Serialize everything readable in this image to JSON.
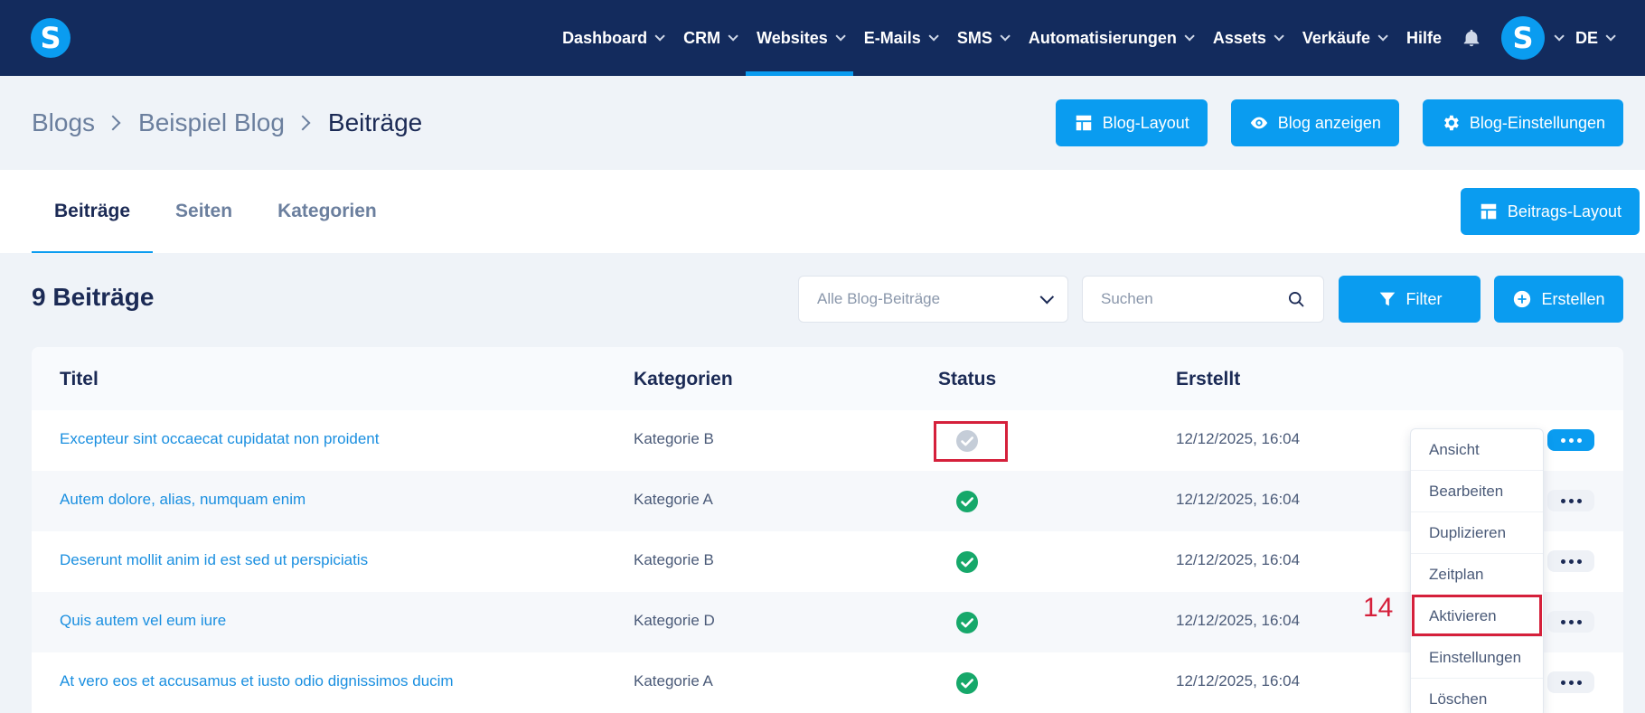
{
  "nav": {
    "logo": "S",
    "items": [
      {
        "label": "Dashboard",
        "dropdown": true,
        "active": false
      },
      {
        "label": "CRM",
        "dropdown": true,
        "active": false
      },
      {
        "label": "Websites",
        "dropdown": true,
        "active": true
      },
      {
        "label": "E-Mails",
        "dropdown": true,
        "active": false
      },
      {
        "label": "SMS",
        "dropdown": true,
        "active": false
      },
      {
        "label": "Automatisierungen",
        "dropdown": true,
        "active": false
      },
      {
        "label": "Assets",
        "dropdown": true,
        "active": false
      },
      {
        "label": "Verkäufe",
        "dropdown": true,
        "active": false
      },
      {
        "label": "Hilfe",
        "dropdown": false,
        "active": false
      }
    ],
    "avatar": "S",
    "language": "DE"
  },
  "breadcrumb": [
    "Blogs",
    "Beispiel Blog",
    "Beiträge"
  ],
  "header_buttons": {
    "blog_layout": "Blog-Layout",
    "blog_view": "Blog anzeigen",
    "blog_settings": "Blog-Einstellungen"
  },
  "tabs": [
    {
      "label": "Beiträge",
      "active": true
    },
    {
      "label": "Seiten",
      "active": false
    },
    {
      "label": "Kategorien",
      "active": false
    }
  ],
  "post_layout_button": "Beitrags-Layout",
  "list": {
    "count_label": "9 Beiträge",
    "select_value": "Alle Blog-Beiträge",
    "search_placeholder": "Suchen",
    "filter_label": "Filter",
    "create_label": "Erstellen"
  },
  "table": {
    "columns": [
      "Titel",
      "Kategorien",
      "Status",
      "Erstellt"
    ],
    "rows": [
      {
        "title": "Excepteur sint occaecat cupidatat non proident",
        "category": "Kategorie B",
        "status": "inactive",
        "created": "12/12/2025, 16:04"
      },
      {
        "title": "Autem dolore, alias, numquam enim",
        "category": "Kategorie A",
        "status": "active",
        "created": "12/12/2025, 16:04"
      },
      {
        "title": "Deserunt mollit anim id est sed ut perspiciatis",
        "category": "Kategorie B",
        "status": "active",
        "created": "12/12/2025, 16:04"
      },
      {
        "title": "Quis autem vel eum iure",
        "category": "Kategorie D",
        "status": "active",
        "created": "12/12/2025, 16:04"
      },
      {
        "title": "At vero eos et accusamus et iusto odio dignissimos ducim",
        "category": "Kategorie A",
        "status": "active",
        "created": "12/12/2025, 16:04"
      }
    ]
  },
  "row_menu": [
    "Ansicht",
    "Bearbeiten",
    "Duplizieren",
    "Zeitplan",
    "Aktivieren",
    "Einstellungen",
    "Löschen"
  ],
  "annotation": {
    "number": "14"
  },
  "colors": {
    "navy": "#132b5d",
    "accent": "#0a9cf0",
    "success": "#16a86a",
    "inactive": "#c5cdd8",
    "highlight": "#d5203b"
  }
}
